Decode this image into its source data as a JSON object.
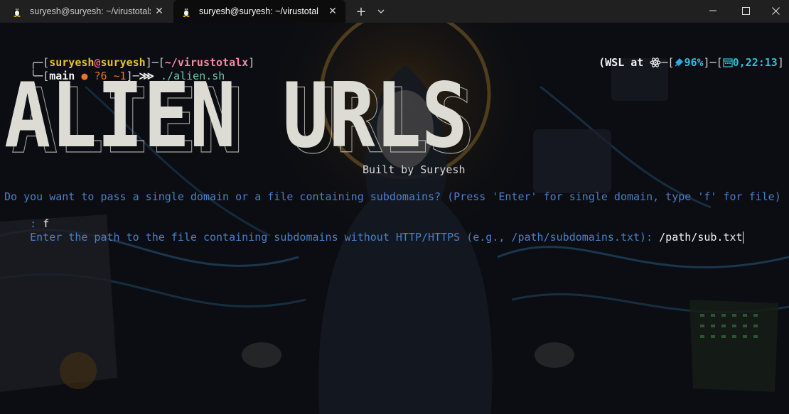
{
  "tabs": [
    {
      "title": "suryesh@suryesh: ~/virustotalx",
      "icon": "linux-penguin-icon",
      "active": false
    },
    {
      "title": "suryesh@suryesh: ~/virustotal",
      "icon": "linux-penguin-icon",
      "active": true
    }
  ],
  "tab_close_glyph": "✕",
  "new_tab_glyph": "+",
  "prompt": {
    "corner_top": "╭─",
    "corner_bottom": "╰─",
    "user": "suryesh",
    "at": "@",
    "host": "suryesh",
    "path": "~/virustotalx",
    "git_icon": "",
    "git_branch": "main",
    "git_dot": "●",
    "git_untracked": "?6",
    "git_modified": "~1",
    "arrow": "⋙",
    "command": "./alien.sh",
    "right_env": "(WSL at ",
    "right_battery": "96%",
    "right_time": "0,22:13",
    "right_close": "]"
  },
  "banner_text": "ALIEN URLS",
  "built_by": "Built by Suryesh",
  "question_line": "Do you want to pass a single domain or a file containing subdomains? (Press 'Enter' for single domain, type 'f' for file)",
  "answer_prefix": ": ",
  "answer": "f",
  "path_prompt": "Enter the path to the file containing subdomains without HTTP/HTTPS (e.g., /path/subdomains.txt): ",
  "path_value": "/path/sub.txt",
  "colors": {
    "terminal_bg": "#0b0d12",
    "tabbar_bg": "#202020",
    "prompt_blue": "#4b7fc9",
    "banner_fill": "#dcdcd4"
  }
}
